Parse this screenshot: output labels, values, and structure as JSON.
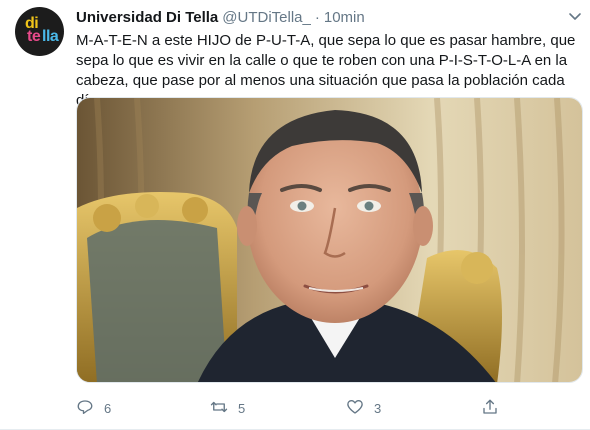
{
  "tweet": {
    "author_name": "Universidad Di Tella",
    "author_handle": "@UTDiTella_",
    "separator": "·",
    "time": "10min",
    "text": "M-A-T-E-N a este HIJO de P-U-T-A, que sepa lo que es pasar hambre, que sepa lo que es vivir en la calle o que te roben con una P-I-S-T-O-L-A en la cabeza, que pase por al menos una situación que pasa la población cada día.",
    "avatar_logo": [
      "di",
      "te",
      "lla"
    ],
    "actions": {
      "reply_count": "6",
      "retweet_count": "5",
      "like_count": "3",
      "share_count": ""
    }
  },
  "icons": {
    "menu": "chevron-down-icon",
    "reply": "reply-icon",
    "retweet": "retweet-icon",
    "like": "heart-icon",
    "share": "share-icon"
  },
  "colors": {
    "text": "#14171a",
    "secondary": "#657786",
    "border": "#e6ecf0"
  }
}
